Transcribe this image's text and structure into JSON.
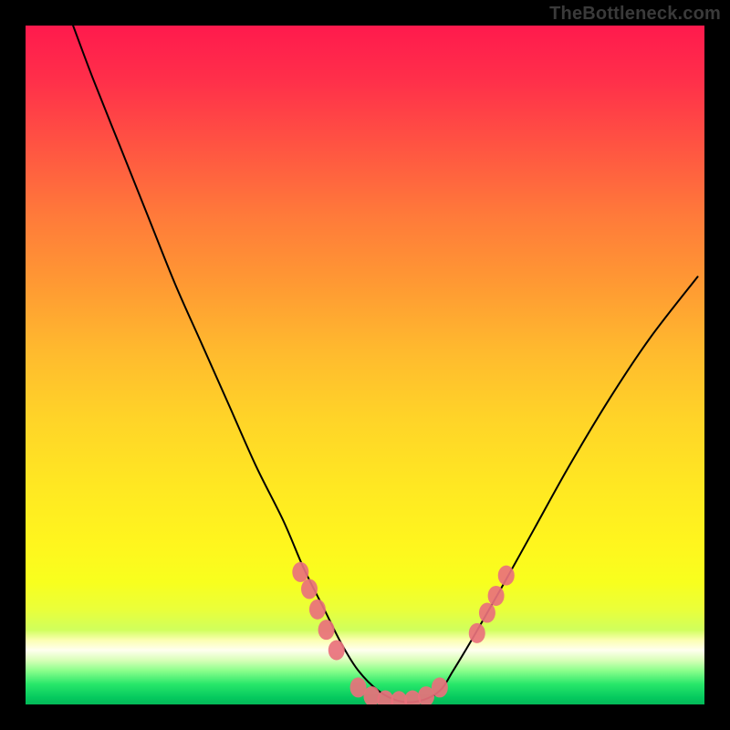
{
  "watermark": "TheBottleneck.com",
  "chart_data": {
    "type": "line",
    "title": "",
    "xlabel": "",
    "ylabel": "",
    "xlim": [
      0,
      100
    ],
    "ylim": [
      0,
      100
    ],
    "series": [
      {
        "name": "curve",
        "x": [
          7,
          10,
          14,
          18,
          22,
          26,
          30,
          34,
          38,
          41,
          44,
          46.5,
          49,
          52,
          55,
          58,
          61,
          63,
          66,
          70,
          75,
          80,
          86,
          92,
          99
        ],
        "y": [
          100,
          92,
          82,
          72,
          62,
          53,
          44,
          35,
          27,
          20,
          14,
          9,
          5,
          2,
          0.5,
          0.5,
          2,
          5,
          10,
          17,
          26,
          35,
          45,
          54,
          63
        ]
      }
    ],
    "markers": [
      {
        "x": 40.5,
        "y": 19.5
      },
      {
        "x": 41.8,
        "y": 17.0
      },
      {
        "x": 43.0,
        "y": 14.0
      },
      {
        "x": 44.3,
        "y": 11.0
      },
      {
        "x": 45.8,
        "y": 8.0
      },
      {
        "x": 49.0,
        "y": 2.5
      },
      {
        "x": 51.0,
        "y": 1.2
      },
      {
        "x": 53.0,
        "y": 0.6
      },
      {
        "x": 55.0,
        "y": 0.5
      },
      {
        "x": 57.0,
        "y": 0.6
      },
      {
        "x": 59.0,
        "y": 1.2
      },
      {
        "x": 61.0,
        "y": 2.5
      },
      {
        "x": 66.5,
        "y": 10.5
      },
      {
        "x": 68.0,
        "y": 13.5
      },
      {
        "x": 69.3,
        "y": 16.0
      },
      {
        "x": 70.8,
        "y": 19.0
      }
    ],
    "gradient_stops": [
      {
        "pos": 0,
        "color": "#ff1a4d"
      },
      {
        "pos": 0.5,
        "color": "#ffd428"
      },
      {
        "pos": 0.92,
        "color": "#ffffef"
      },
      {
        "pos": 1.0,
        "color": "#04b858"
      }
    ]
  }
}
